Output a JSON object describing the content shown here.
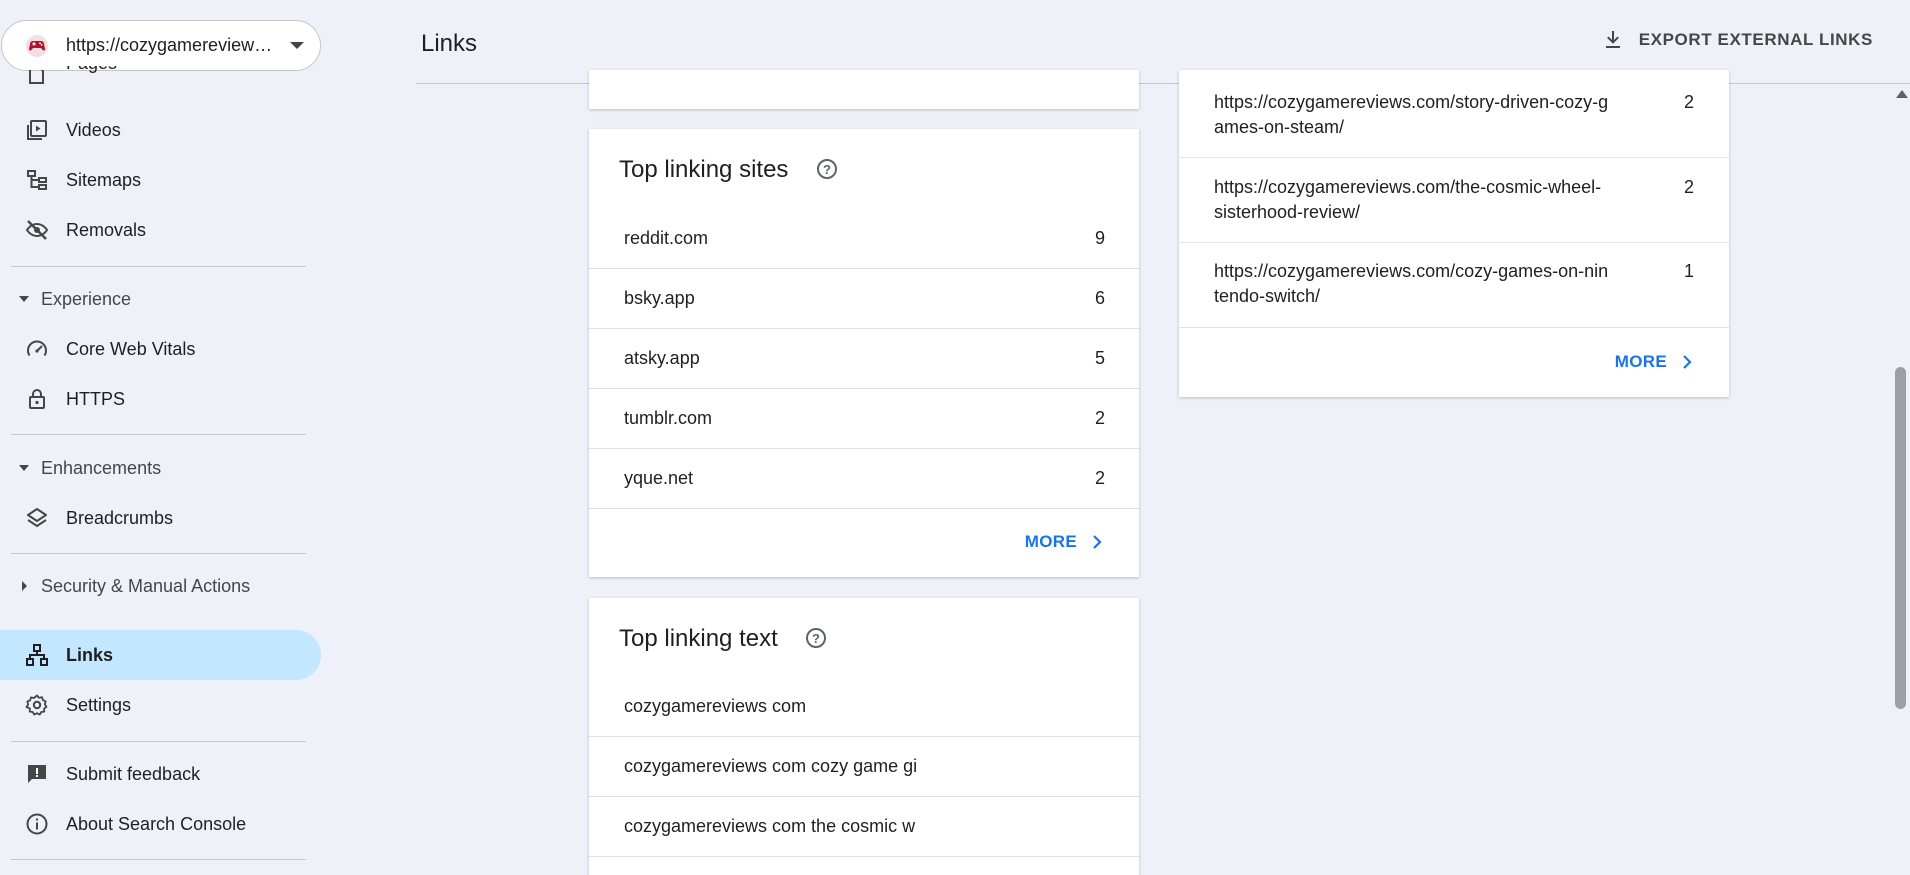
{
  "property": {
    "url": "https://cozygamereviews.com/",
    "icon": "gamepad-icon"
  },
  "sidebar": {
    "partial_item": "Pages",
    "items_top": [
      {
        "label": "Videos",
        "icon": "video-icon"
      },
      {
        "label": "Sitemaps",
        "icon": "sitemap-icon"
      },
      {
        "label": "Removals",
        "icon": "eye-off-icon"
      }
    ],
    "experience": {
      "label": "Experience",
      "items": [
        {
          "label": "Core Web Vitals",
          "icon": "gauge-icon"
        },
        {
          "label": "HTTPS",
          "icon": "lock-icon"
        }
      ]
    },
    "enhancements": {
      "label": "Enhancements",
      "items": [
        {
          "label": "Breadcrumbs",
          "icon": "layers-icon"
        }
      ]
    },
    "security": {
      "label": "Security & Manual Actions"
    },
    "links": {
      "label": "Links",
      "icon": "links-icon"
    },
    "settings": {
      "label": "Settings",
      "icon": "gear-icon"
    },
    "footer": [
      {
        "label": "Submit feedback",
        "icon": "feedback-icon"
      },
      {
        "label": "About Search Console",
        "icon": "info-icon"
      }
    ]
  },
  "header": {
    "title": "Links",
    "export_label": "EXPORT EXTERNAL LINKS"
  },
  "top_linking_sites": {
    "title": "Top linking sites",
    "rows": [
      {
        "site": "reddit.com",
        "count": "9"
      },
      {
        "site": "bsky.app",
        "count": "6"
      },
      {
        "site": "atsky.app",
        "count": "5"
      },
      {
        "site": "tumblr.com",
        "count": "2"
      },
      {
        "site": "yque.net",
        "count": "2"
      }
    ],
    "more_label": "MORE"
  },
  "top_linking_text": {
    "title": "Top linking text",
    "rows": [
      {
        "text": "cozygamereviews com"
      },
      {
        "text": "cozygamereviews com cozy game gi"
      },
      {
        "text": "cozygamereviews com the cosmic w"
      }
    ]
  },
  "top_linked_pages": {
    "rows": [
      {
        "line1": "https://cozygamereviews.com/story-driven-cozy-g",
        "line2": "ames-on-steam/",
        "count": "2"
      },
      {
        "line1": "https://cozygamereviews.com/the-cosmic-wheel-",
        "line2": "sisterhood-review/",
        "count": "2"
      },
      {
        "line1": "https://cozygamereviews.com/cozy-games-on-nin",
        "line2": "tendo-switch/",
        "count": "1"
      }
    ],
    "more_label": "MORE"
  },
  "colors": {
    "accent": "#1a73e8",
    "active_nav": "#c2e7ff",
    "background": "#eef2f8"
  }
}
